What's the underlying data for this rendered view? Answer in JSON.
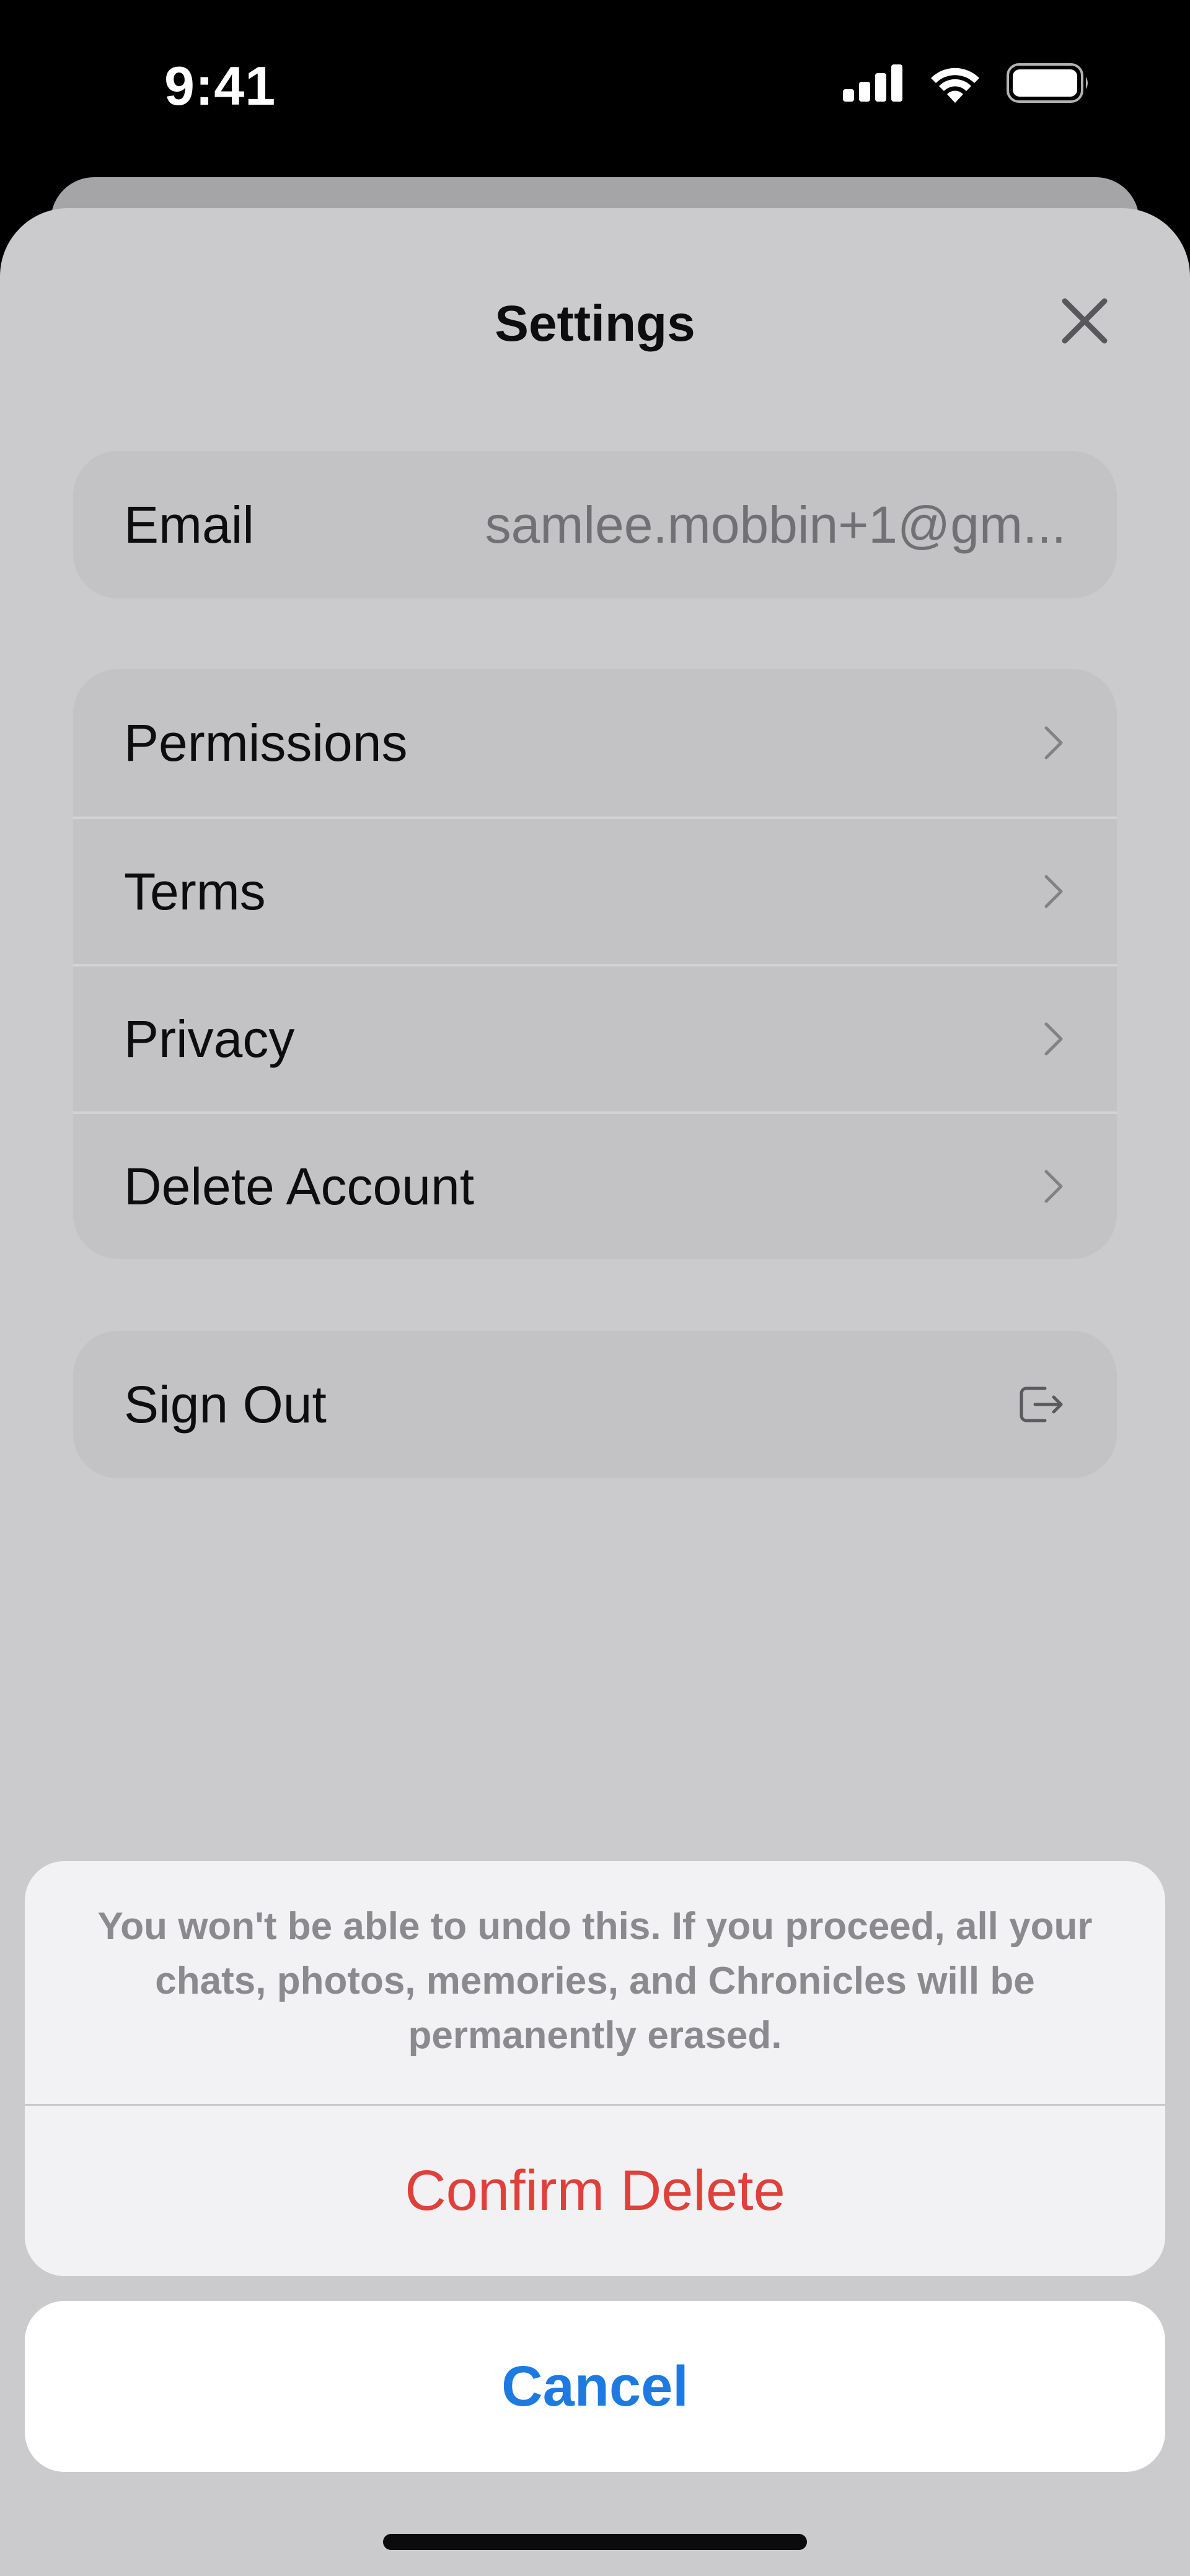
{
  "status_bar": {
    "time": "9:41"
  },
  "sheet": {
    "title": "Settings"
  },
  "account": {
    "email_label": "Email",
    "email_value": "samlee.mobbin+1@gm..."
  },
  "menu": {
    "items": [
      {
        "label": "Permissions"
      },
      {
        "label": "Terms"
      },
      {
        "label": "Privacy"
      },
      {
        "label": "Delete Account"
      }
    ]
  },
  "sign_out": {
    "label": "Sign Out"
  },
  "action_sheet": {
    "message": "You won't be able to undo this. If you proceed, all your chats, photos, memories, and Chronicles will be permanently erased.",
    "confirm_label": "Confirm Delete",
    "cancel_label": "Cancel"
  },
  "colors": {
    "destructive": "#e0403a",
    "accent": "#1d7ae0",
    "sheet_bg": "#cbcacd",
    "action_bg": "#f2f1f4"
  },
  "icons": {
    "close": "close-icon",
    "chevron": "chevron-right-icon",
    "sign_out": "sign-out-icon",
    "signal": "cellular-signal-icon",
    "wifi": "wifi-icon",
    "battery": "battery-icon"
  }
}
